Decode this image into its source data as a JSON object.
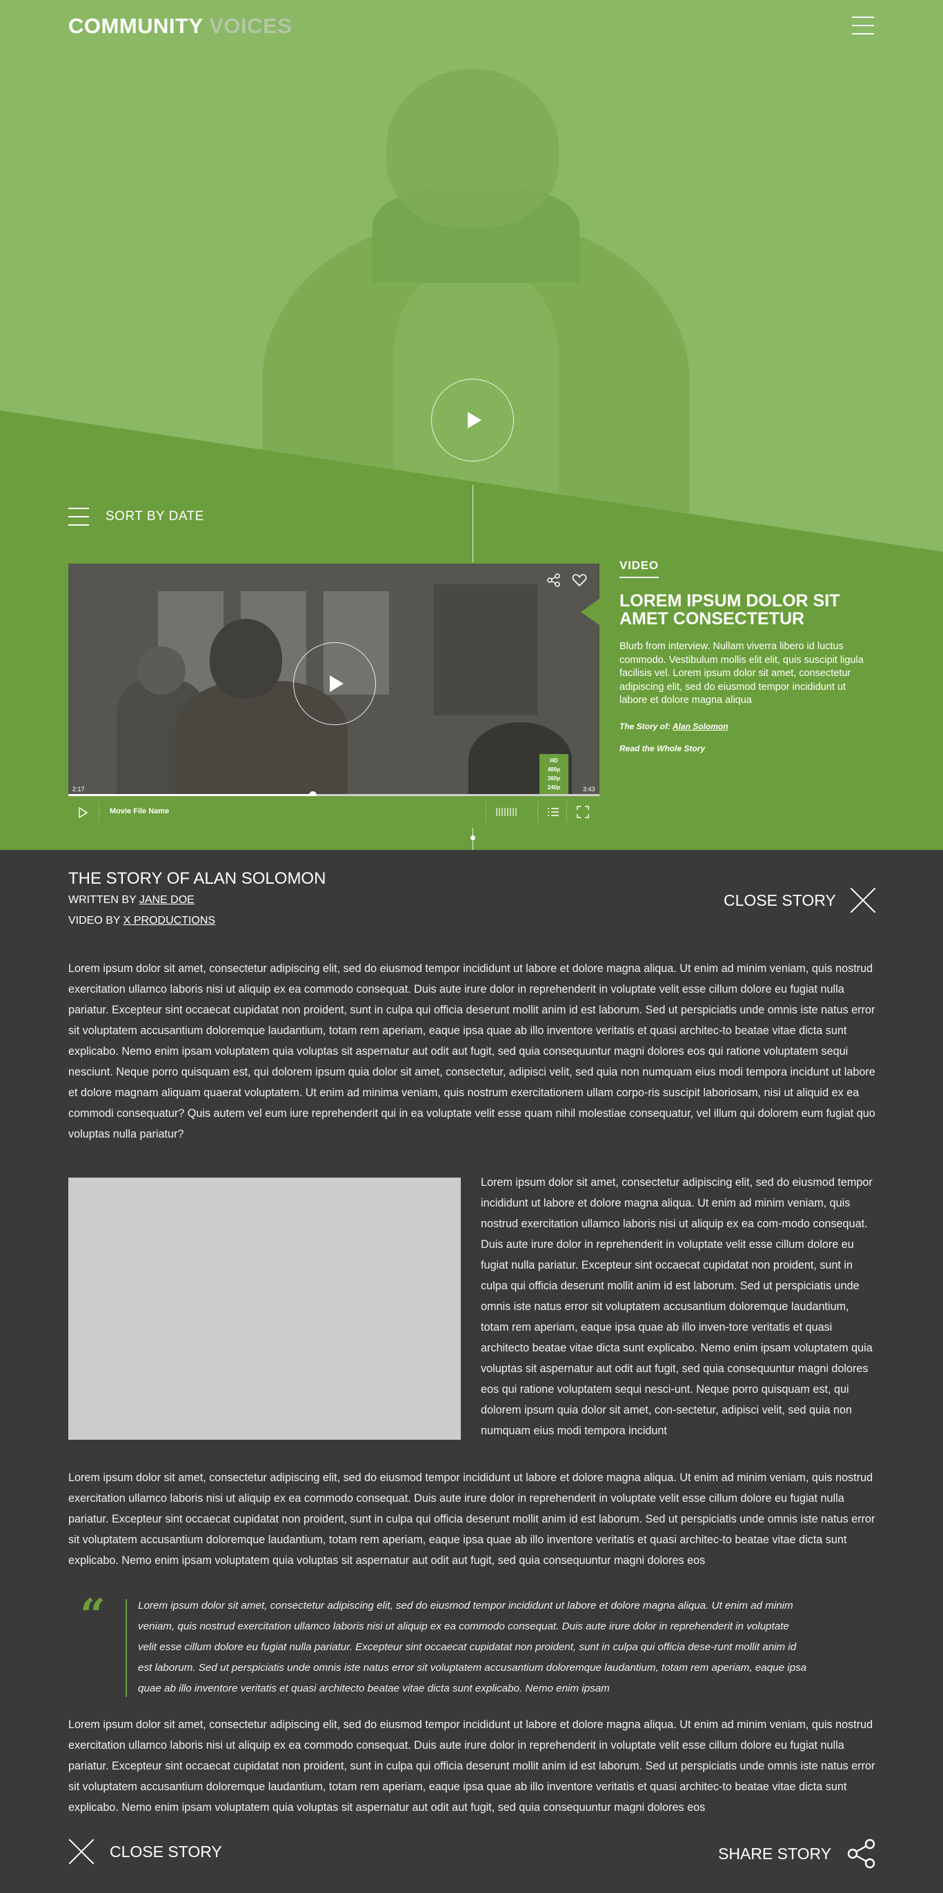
{
  "header": {
    "logo_part1": "COMMUNITY",
    "logo_part2": "VOICES",
    "menu_icon": "hamburger-menu-icon"
  },
  "hero": {
    "play_icon": "play-icon"
  },
  "sort": {
    "label": "SORT BY DATE",
    "icon": "list-icon"
  },
  "player": {
    "current_time": "2:17",
    "total_time": "3:43",
    "progress": 0.46,
    "file_name": "Movie File Name",
    "quality_options": [
      "HD",
      "480p",
      "360p",
      "240p"
    ],
    "icons": [
      "share-icon",
      "heart-icon",
      "play-icon",
      "volume-icon",
      "playlist-icon",
      "fullscreen-icon"
    ]
  },
  "video_info": {
    "tag": "VIDEO",
    "title": "LOREM IPSUM DOLOR SIT AMET CONSECTETUR",
    "blurb": "Blurb from interview. Nullam viverra libero id luctus commodo. Vestibulum mollis elit elit, quis suscipit ligula facilisis vel. Lorem ipsum dolor sit amet, consectetur adipiscing elit, sed do eiusmod tempor incididunt ut labore et dolore magna aliqua",
    "story_of_prefix": "The Story of:",
    "story_of_name": "Alan Solomon",
    "read_whole": "Read the Whole Story"
  },
  "article": {
    "title": "THE STORY OF ALAN SOLOMON",
    "written_by_prefix": "WRITTEN BY",
    "written_by_name": "JANE DOE",
    "video_by_prefix": "VIDEO BY",
    "video_by_name": "X PRODUCTIONS",
    "close_label": "CLOSE STORY",
    "para1": "Lorem ipsum dolor sit amet, consectetur adipiscing elit, sed do eiusmod tempor incididunt ut labore et dolore magna aliqua. Ut enim ad minim veniam, quis nostrud exercitation ullamco laboris nisi ut aliquip ex ea commodo consequat. Duis aute irure dolor in reprehenderit in voluptate velit esse cillum dolore eu fugiat nulla pariatur. Excepteur sint occaecat cupidatat non proident, sunt in culpa qui officia deserunt mollit anim id est laborum. Sed ut perspiciatis unde omnis iste natus error sit voluptatem accusantium doloremque laudantium, totam rem aperiam, eaque ipsa quae ab illo inventore veritatis et quasi architec-to beatae vitae dicta sunt explicabo. Nemo enim ipsam voluptatem quia voluptas sit aspernatur aut odit aut fugit, sed quia consequuntur magni dolores eos qui ratione voluptatem sequi nesciunt. Neque porro quisquam est, qui dolorem ipsum quia dolor sit amet, consectetur, adipisci velit, sed quia non numquam eius modi tempora incidunt ut labore et dolore magnam aliquam quaerat voluptatem. Ut enim ad minima veniam, quis nostrum exercitationem ullam corpo-ris suscipit laboriosam, nisi ut aliquid ex ea commodi consequatur? Quis autem vel eum iure reprehenderit qui in ea voluptate velit esse quam nihil molestiae consequatur, vel illum qui dolorem eum fugiat quo voluptas nulla pariatur?",
    "side_para": "Lorem ipsum dolor sit amet, consectetur adipiscing elit, sed do eiusmod tempor incididunt ut labore et dolore magna aliqua. Ut enim ad minim veniam, quis nostrud exercitation ullamco laboris nisi ut aliquip ex ea com-modo consequat. Duis aute irure dolor in reprehenderit in voluptate velit esse cillum dolore eu fugiat nulla pariatur. Excepteur sint occaecat cupidatat non proident, sunt in culpa qui officia deserunt mollit anim id est laborum. Sed ut perspiciatis unde omnis iste natus error sit voluptatem accusantium doloremque laudantium, totam rem aperiam, eaque ipsa quae ab illo inven-tore veritatis et quasi architecto beatae vitae dicta sunt explicabo. Nemo enim ipsam voluptatem quia voluptas sit aspernatur aut odit aut fugit, sed quia consequuntur magni dolores eos qui ratione voluptatem sequi nesci-unt. Neque porro quisquam est, qui dolorem ipsum quia dolor sit amet, con-sectetur, adipisci velit, sed quia non numquam eius modi tempora incidunt",
    "para2": "Lorem ipsum dolor sit amet, consectetur adipiscing elit, sed do eiusmod tempor incididunt ut labore et dolore magna aliqua. Ut enim ad minim veniam, quis nostrud exercitation ullamco laboris nisi ut aliquip ex ea commodo consequat. Duis aute irure dolor in reprehenderit in voluptate velit esse cillum dolore eu fugiat nulla pariatur. Excepteur sint occaecat cupidatat non proident, sunt in culpa qui officia deserunt mollit anim id est laborum. Sed ut perspiciatis unde omnis iste natus error sit voluptatem accusantium doloremque laudantium, totam rem aperiam, eaque ipsa quae ab illo inventore veritatis et quasi architec-to beatae vitae dicta sunt explicabo. Nemo enim ipsam voluptatem quia voluptas sit aspernatur aut odit aut fugit, sed quia consequuntur magni dolores eos",
    "quote_mark": "“",
    "quote": "Lorem ipsum dolor sit amet, consectetur adipiscing elit, sed do eiusmod tempor incididunt ut labore et dolore magna aliqua. Ut enim ad minim veniam, quis nostrud exercitation ullamco laboris nisi ut aliquip ex ea commodo consequat. Duis aute irure dolor in reprehenderit in voluptate velit esse cillum dolore eu fugiat nulla pariatur. Excepteur sint occaecat cupidatat non proident, sunt in culpa qui officia dese-runt mollit anim id est laborum. Sed ut perspiciatis unde omnis iste natus error sit voluptatem accusantium doloremque laudantium, totam rem aperiam, eaque ipsa quae ab illo inventore veritatis et quasi architecto beatae vitae dicta sunt explicabo. Nemo enim ipsam",
    "para3": "Lorem ipsum dolor sit amet, consectetur adipiscing elit, sed do eiusmod tempor incididunt ut labore et dolore magna aliqua. Ut enim ad minim veniam, quis nostrud exercitation ullamco laboris nisi ut aliquip ex ea commodo consequat. Duis aute irure dolor in reprehenderit in voluptate velit esse cillum dolore eu fugiat nulla pariatur. Excepteur sint occaecat cupidatat non proident, sunt in culpa qui officia deserunt mollit anim id est laborum. Sed ut perspiciatis unde omnis iste natus error sit voluptatem accusantium doloremque laudantium, totam rem aperiam, eaque ipsa quae ab illo inventore veritatis et quasi architec-to beatae vitae dicta sunt explicabo. Nemo enim ipsam voluptatem quia voluptas sit aspernatur aut odit aut fugit, sed quia consequuntur magni dolores eos"
  },
  "footer": {
    "close_label": "CLOSE STORY",
    "share_label": "SHARE STORY"
  },
  "colors": {
    "brand_green": "#6b9e3c",
    "light_green": "#8ab864",
    "dark_bg": "#3a3a3a",
    "logo_accent": "#b5c6a6"
  }
}
